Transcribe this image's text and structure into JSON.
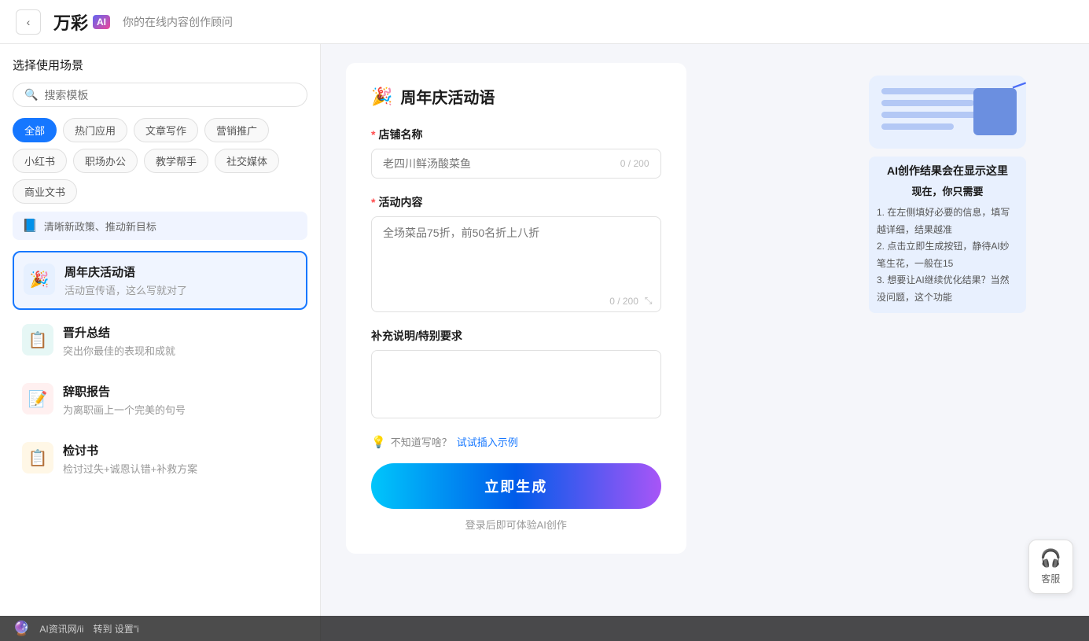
{
  "header": {
    "back_label": "‹",
    "logo_text": "万彩",
    "logo_ai": "AI",
    "subtitle": "你的在线内容创作顾问"
  },
  "sidebar": {
    "title": "选择使用场景",
    "search_placeholder": "搜索模板",
    "tags": [
      {
        "label": "全部",
        "active": true
      },
      {
        "label": "热门应用",
        "active": false
      },
      {
        "label": "文章写作",
        "active": false
      },
      {
        "label": "营销推广",
        "active": false
      },
      {
        "label": "小红书",
        "active": false
      },
      {
        "label": "职场办公",
        "active": false
      },
      {
        "label": "教学帮手",
        "active": false
      },
      {
        "label": "社交媒体",
        "active": false
      },
      {
        "label": "商业文书",
        "active": false
      }
    ],
    "policy_text": "清晰新政策、推动新目标",
    "templates": [
      {
        "id": "anniversary",
        "icon": "🎉",
        "icon_type": "blue",
        "name": "周年庆活动语",
        "desc": "活动宣传语，这么写就对了",
        "active": true
      },
      {
        "id": "promotion",
        "icon": "📋",
        "icon_type": "teal",
        "name": "晋升总结",
        "desc": "突出你最佳的表现和成就",
        "active": false
      },
      {
        "id": "resignation",
        "icon": "📝",
        "icon_type": "red",
        "name": "辞职报告",
        "desc": "为离职画上一个完美的句号",
        "active": false
      },
      {
        "id": "review",
        "icon": "📋",
        "icon_type": "orange",
        "name": "检讨书",
        "desc": "检讨过失+诚恩认错+补救方案",
        "active": false
      }
    ]
  },
  "form": {
    "title": "周年庆活动语",
    "title_icon": "🎉",
    "fields": {
      "store_name": {
        "label": "店铺名称",
        "required": true,
        "placeholder": "老四川鲜汤酸菜鱼",
        "char_count": "0 / 200"
      },
      "activity_content": {
        "label": "活动内容",
        "required": true,
        "placeholder": "全场菜品75折，前50名折上八折",
        "char_count": "0 / 200"
      },
      "supplement": {
        "label": "补充说明/特别要求",
        "required": false,
        "placeholder": ""
      }
    },
    "hint_text": "不知道写啥？试试插入示例",
    "generate_btn": "立即生成",
    "login_hint": "登录后即可体验AI创作"
  },
  "ai_hint": {
    "title": "AI创作结果会在显示这里",
    "subtitle": "现在，你只需要",
    "steps": [
      "1. 在左侧填好必要的信息，填写越详细，结果越准",
      "2. 点击立即生成按钮，静待AI妙笔生花，一般在15",
      "3. 想要让AI继续优化结果？当然没问题，这个功能"
    ]
  },
  "customer_service": {
    "icon": "🎧",
    "label": "客服"
  },
  "bottom_bar": {
    "logo": "🔮",
    "text": "AI资讯网/ii",
    "text2": "转到 设置\"i"
  }
}
